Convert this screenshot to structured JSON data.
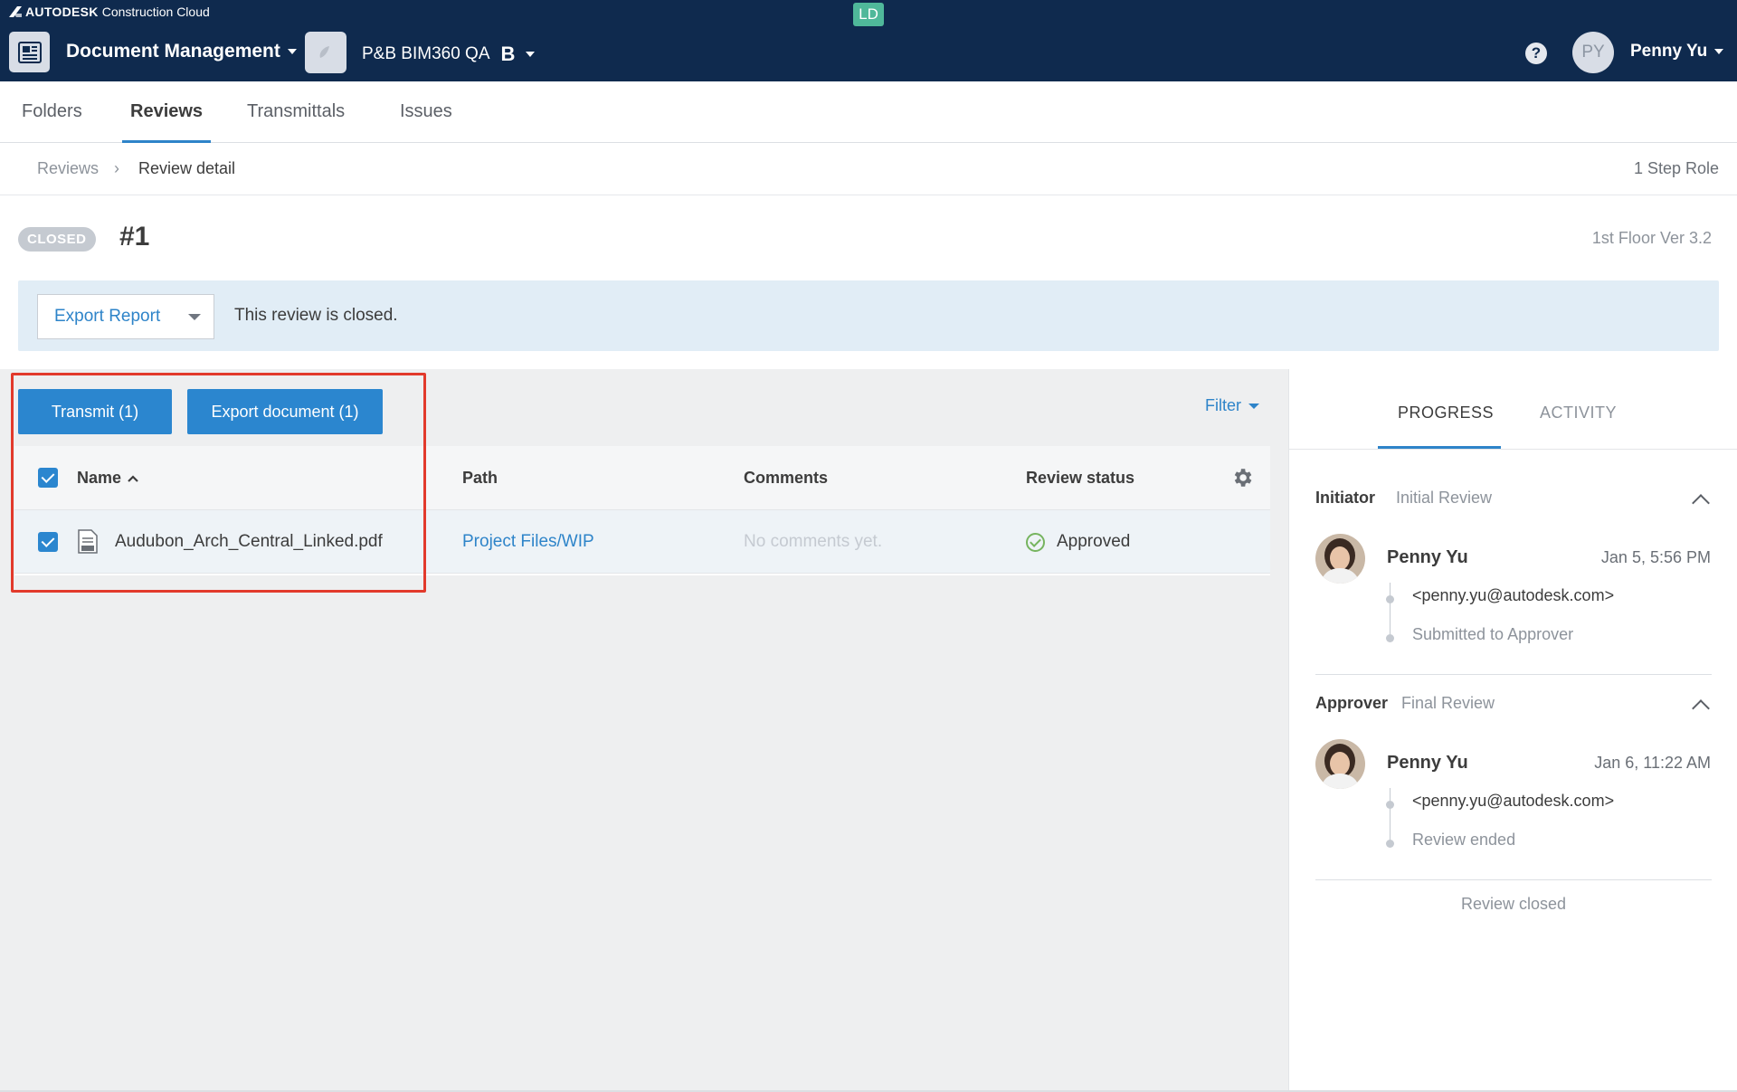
{
  "header": {
    "brand_bold": "AUTODESK",
    "brand_rest": "Construction Cloud",
    "ld_badge": "LD",
    "module": "Document Management",
    "project": "P&B BIM360 QA",
    "project_icon": "B",
    "help": "?",
    "user_initials": "PY",
    "user_name": "Penny Yu"
  },
  "tabs": [
    {
      "label": "Folders"
    },
    {
      "label": "Reviews"
    },
    {
      "label": "Transmittals"
    },
    {
      "label": "Issues"
    }
  ],
  "breadcrumb": {
    "root": "Reviews",
    "separator": "›",
    "current": "Review detail",
    "right": "1 Step Role"
  },
  "review": {
    "status": "CLOSED",
    "number": "#1",
    "version": "1st Floor Ver 3.2",
    "export_report": "Export Report",
    "closed_message": "This review is closed."
  },
  "actions": {
    "transmit": "Transmit (1)",
    "export_document": "Export document (1)",
    "filter": "Filter"
  },
  "table": {
    "columns": [
      "Name",
      "Path",
      "Comments",
      "Review status"
    ],
    "sort_indicator": "^",
    "rows": [
      {
        "name": "Audubon_Arch_Central_Linked.pdf",
        "path": "Project Files/WIP",
        "comments": "No comments yet.",
        "status": "Approved"
      }
    ]
  },
  "side_panel": {
    "tabs": [
      "PROGRESS",
      "ACTIVITY"
    ],
    "steps": [
      {
        "role": "Initiator",
        "step": "Initial Review",
        "name": "Penny Yu",
        "time": "Jan 5, 5:56 PM",
        "email": "<penny.yu@autodesk.com>",
        "status": "Submitted to Approver"
      },
      {
        "role": "Approver",
        "step": "Final Review",
        "name": "Penny Yu",
        "time": "Jan 6, 11:22 AM",
        "email": "<penny.yu@autodesk.com>",
        "status": "Review ended"
      }
    ],
    "footer": "Review closed"
  },
  "colors": {
    "header_bg": "#0f2a4e",
    "accent_blue": "#2b86cf",
    "approved_green": "#76b45f",
    "highlight_red": "#e23a2c"
  },
  "icons": [
    "autodesk-logo-icon",
    "document-management-icon",
    "project-thumb-icon",
    "help-icon",
    "settings-gear-icon",
    "pdf-file-icon",
    "approved-check-icon",
    "chevron-up-icon"
  ]
}
